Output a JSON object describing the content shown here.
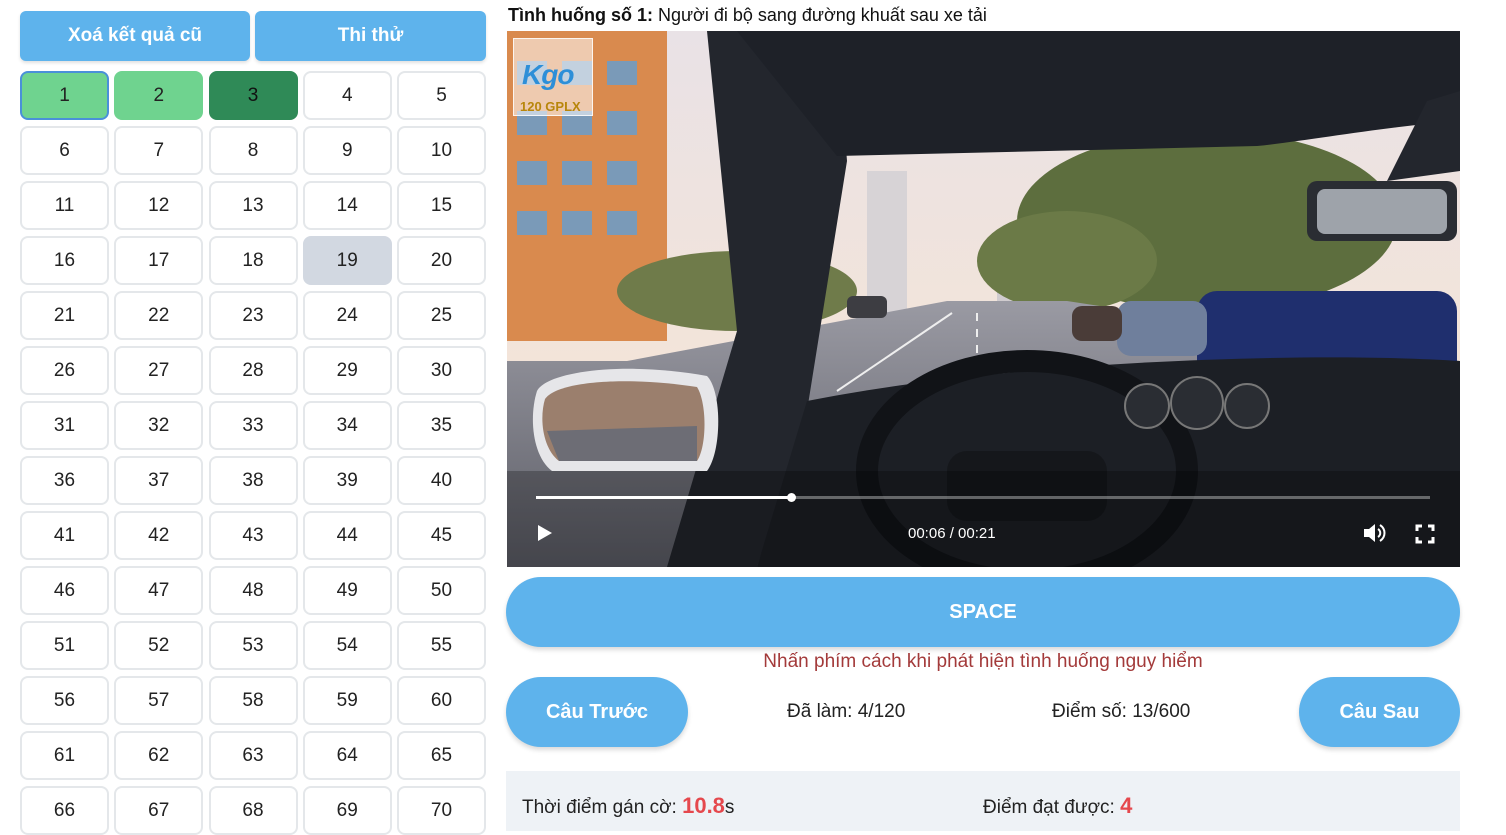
{
  "top_buttons": {
    "clear_label": "Xoá kết quả cũ",
    "test_label": "Thi thử"
  },
  "question_grid": {
    "items": [
      {
        "n": "1",
        "state": "done current"
      },
      {
        "n": "2",
        "state": "done"
      },
      {
        "n": "3",
        "state": "dark"
      },
      {
        "n": "4",
        "state": ""
      },
      {
        "n": "5",
        "state": ""
      },
      {
        "n": "6",
        "state": ""
      },
      {
        "n": "7",
        "state": ""
      },
      {
        "n": "8",
        "state": ""
      },
      {
        "n": "9",
        "state": ""
      },
      {
        "n": "10",
        "state": ""
      },
      {
        "n": "11",
        "state": ""
      },
      {
        "n": "12",
        "state": ""
      },
      {
        "n": "13",
        "state": ""
      },
      {
        "n": "14",
        "state": ""
      },
      {
        "n": "15",
        "state": ""
      },
      {
        "n": "16",
        "state": ""
      },
      {
        "n": "17",
        "state": ""
      },
      {
        "n": "18",
        "state": ""
      },
      {
        "n": "19",
        "state": "viewed"
      },
      {
        "n": "20",
        "state": ""
      },
      {
        "n": "21",
        "state": ""
      },
      {
        "n": "22",
        "state": ""
      },
      {
        "n": "23",
        "state": ""
      },
      {
        "n": "24",
        "state": ""
      },
      {
        "n": "25",
        "state": ""
      },
      {
        "n": "26",
        "state": ""
      },
      {
        "n": "27",
        "state": ""
      },
      {
        "n": "28",
        "state": ""
      },
      {
        "n": "29",
        "state": ""
      },
      {
        "n": "30",
        "state": ""
      },
      {
        "n": "31",
        "state": ""
      },
      {
        "n": "32",
        "state": ""
      },
      {
        "n": "33",
        "state": ""
      },
      {
        "n": "34",
        "state": ""
      },
      {
        "n": "35",
        "state": ""
      },
      {
        "n": "36",
        "state": ""
      },
      {
        "n": "37",
        "state": ""
      },
      {
        "n": "38",
        "state": ""
      },
      {
        "n": "39",
        "state": ""
      },
      {
        "n": "40",
        "state": ""
      },
      {
        "n": "41",
        "state": ""
      },
      {
        "n": "42",
        "state": ""
      },
      {
        "n": "43",
        "state": ""
      },
      {
        "n": "44",
        "state": ""
      },
      {
        "n": "45",
        "state": ""
      },
      {
        "n": "46",
        "state": ""
      },
      {
        "n": "47",
        "state": ""
      },
      {
        "n": "48",
        "state": ""
      },
      {
        "n": "49",
        "state": ""
      },
      {
        "n": "50",
        "state": ""
      },
      {
        "n": "51",
        "state": ""
      },
      {
        "n": "52",
        "state": ""
      },
      {
        "n": "53",
        "state": ""
      },
      {
        "n": "54",
        "state": ""
      },
      {
        "n": "55",
        "state": ""
      },
      {
        "n": "56",
        "state": ""
      },
      {
        "n": "57",
        "state": ""
      },
      {
        "n": "58",
        "state": ""
      },
      {
        "n": "59",
        "state": ""
      },
      {
        "n": "60",
        "state": ""
      },
      {
        "n": "61",
        "state": ""
      },
      {
        "n": "62",
        "state": ""
      },
      {
        "n": "63",
        "state": ""
      },
      {
        "n": "64",
        "state": ""
      },
      {
        "n": "65",
        "state": ""
      },
      {
        "n": "66",
        "state": ""
      },
      {
        "n": "67",
        "state": ""
      },
      {
        "n": "68",
        "state": ""
      },
      {
        "n": "69",
        "state": ""
      },
      {
        "n": "70",
        "state": ""
      }
    ]
  },
  "question": {
    "label": "Tình huống số 1:",
    "text": " Người đi bộ sang đường khuất sau xe tải"
  },
  "video": {
    "logo_text": "Kgo",
    "logo_sub": "120 GPLX",
    "time_display": "00:06 / 00:21",
    "progress": 0.2857,
    "play_icon": "play-icon",
    "volume_icon": "volume-icon",
    "fullscreen_icon": "fullscreen-icon"
  },
  "space_button": {
    "label": "SPACE"
  },
  "hint": "Nhấn phím cách khi phát hiện tình huống nguy hiểm",
  "nav": {
    "prev_label": "Câu Trước",
    "next_label": "Câu Sau",
    "done_text": "Đã làm: 4/120",
    "score_text": "Điểm số: 13/600"
  },
  "result": {
    "time_label": "Thời điểm gán cờ: ",
    "time_value": "10.8",
    "time_unit": "s",
    "points_label": "Điểm đạt được: ",
    "points_value": "4"
  },
  "colors": {
    "accent": "#5eb3ec",
    "done": "#6fd38f",
    "dark_done": "#2f8a57",
    "viewed": "#d2d8e1",
    "hint": "#a33a3a",
    "highlight": "#e5484d"
  }
}
